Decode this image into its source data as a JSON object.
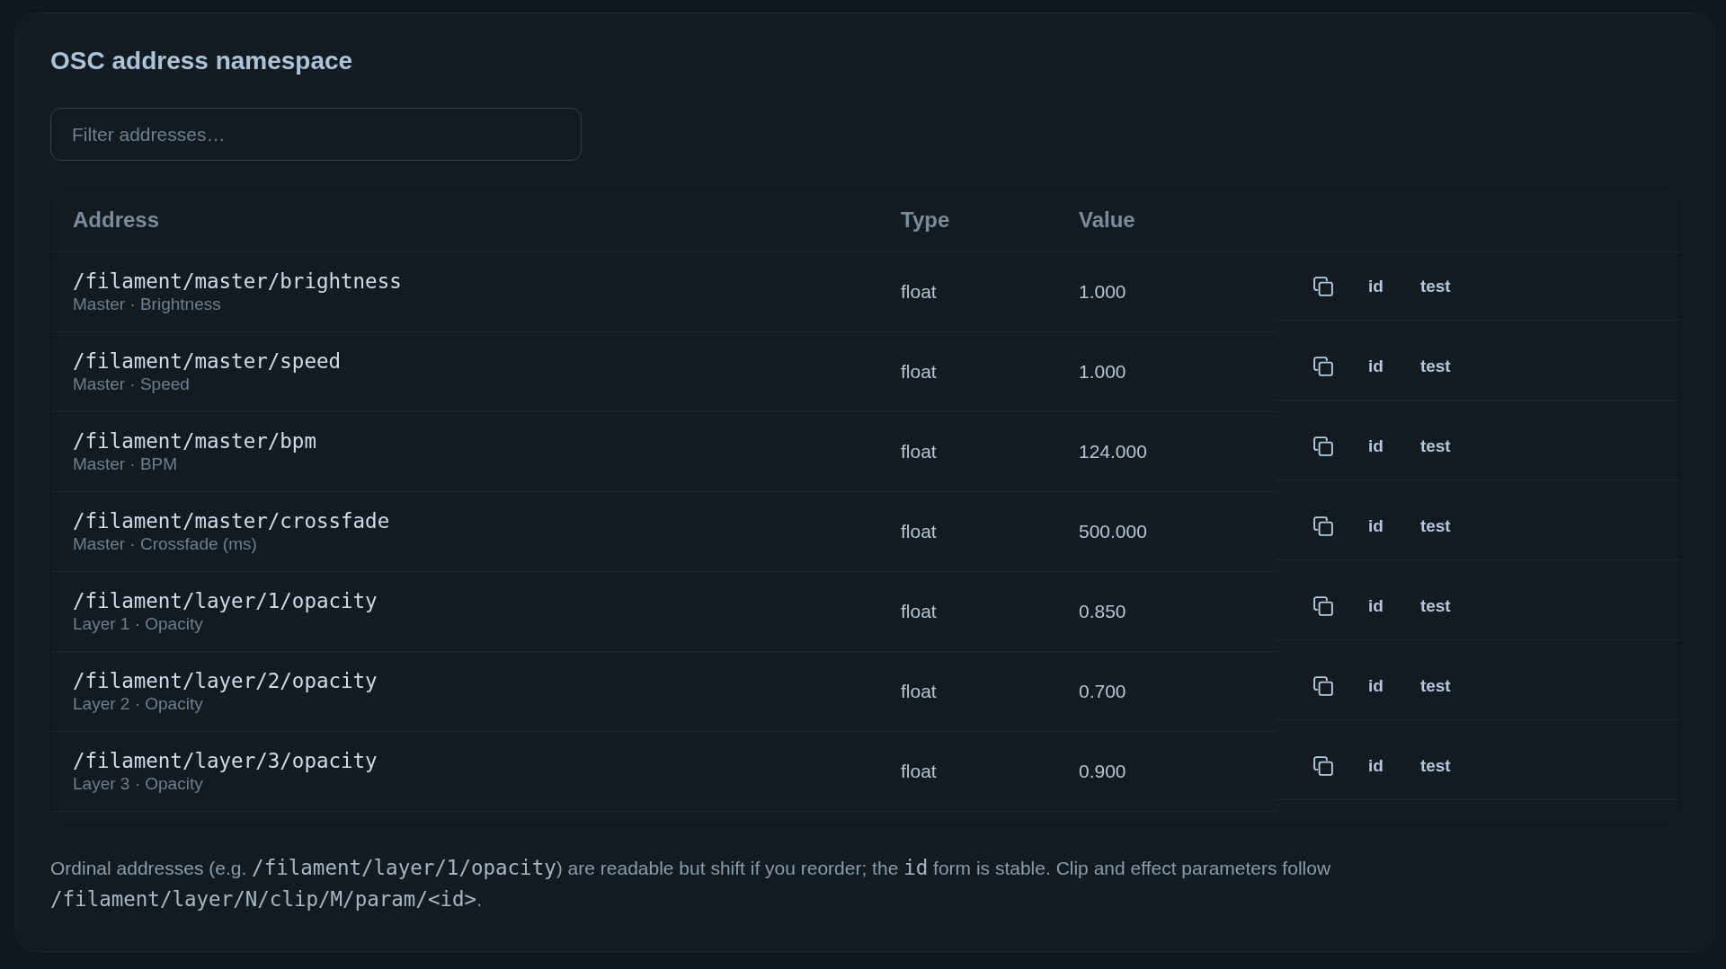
{
  "panel": {
    "title": "OSC address namespace"
  },
  "filter": {
    "placeholder": "Filter addresses…"
  },
  "table": {
    "columns": [
      "Address",
      "Type",
      "Value"
    ],
    "rows": [
      {
        "address": "/filament/master/brightness",
        "label": "Master · Brightness",
        "type": "float",
        "value": "1.000",
        "actions": [
          "id",
          "test"
        ]
      },
      {
        "address": "/filament/master/speed",
        "label": "Master · Speed",
        "type": "float",
        "value": "1.000",
        "actions": [
          "id",
          "test"
        ]
      },
      {
        "address": "/filament/master/bpm",
        "label": "Master · BPM",
        "type": "float",
        "value": "124.000",
        "actions": [
          "id",
          "test"
        ]
      },
      {
        "address": "/filament/master/crossfade",
        "label": "Master · Crossfade (ms)",
        "type": "float",
        "value": "500.000",
        "actions": [
          "id",
          "test"
        ]
      },
      {
        "address": "/filament/layer/1/opacity",
        "label": "Layer 1 · Opacity",
        "type": "float",
        "value": "0.850",
        "actions": [
          "id",
          "test"
        ]
      },
      {
        "address": "/filament/layer/2/opacity",
        "label": "Layer 2 · Opacity",
        "type": "float",
        "value": "0.700",
        "actions": [
          "id",
          "test"
        ]
      },
      {
        "address": "/filament/layer/3/opacity",
        "label": "Layer 3 · Opacity",
        "type": "float",
        "value": "0.900",
        "actions": [
          "id",
          "test"
        ]
      }
    ]
  },
  "footnote": [
    {
      "kind": "text",
      "text": "Ordinal addresses (e.g. "
    },
    {
      "kind": "code",
      "text": "/filament/layer/1/opacity"
    },
    {
      "kind": "text",
      "text": ") are readable but shift if you reorder; the "
    },
    {
      "kind": "code",
      "text": "id"
    },
    {
      "kind": "text",
      "text": " form is stable. Clip and effect parameters follow "
    },
    {
      "kind": "code",
      "text": "/filament/layer/N/clip/M/param/<id>"
    },
    {
      "kind": "text",
      "text": "."
    }
  ]
}
